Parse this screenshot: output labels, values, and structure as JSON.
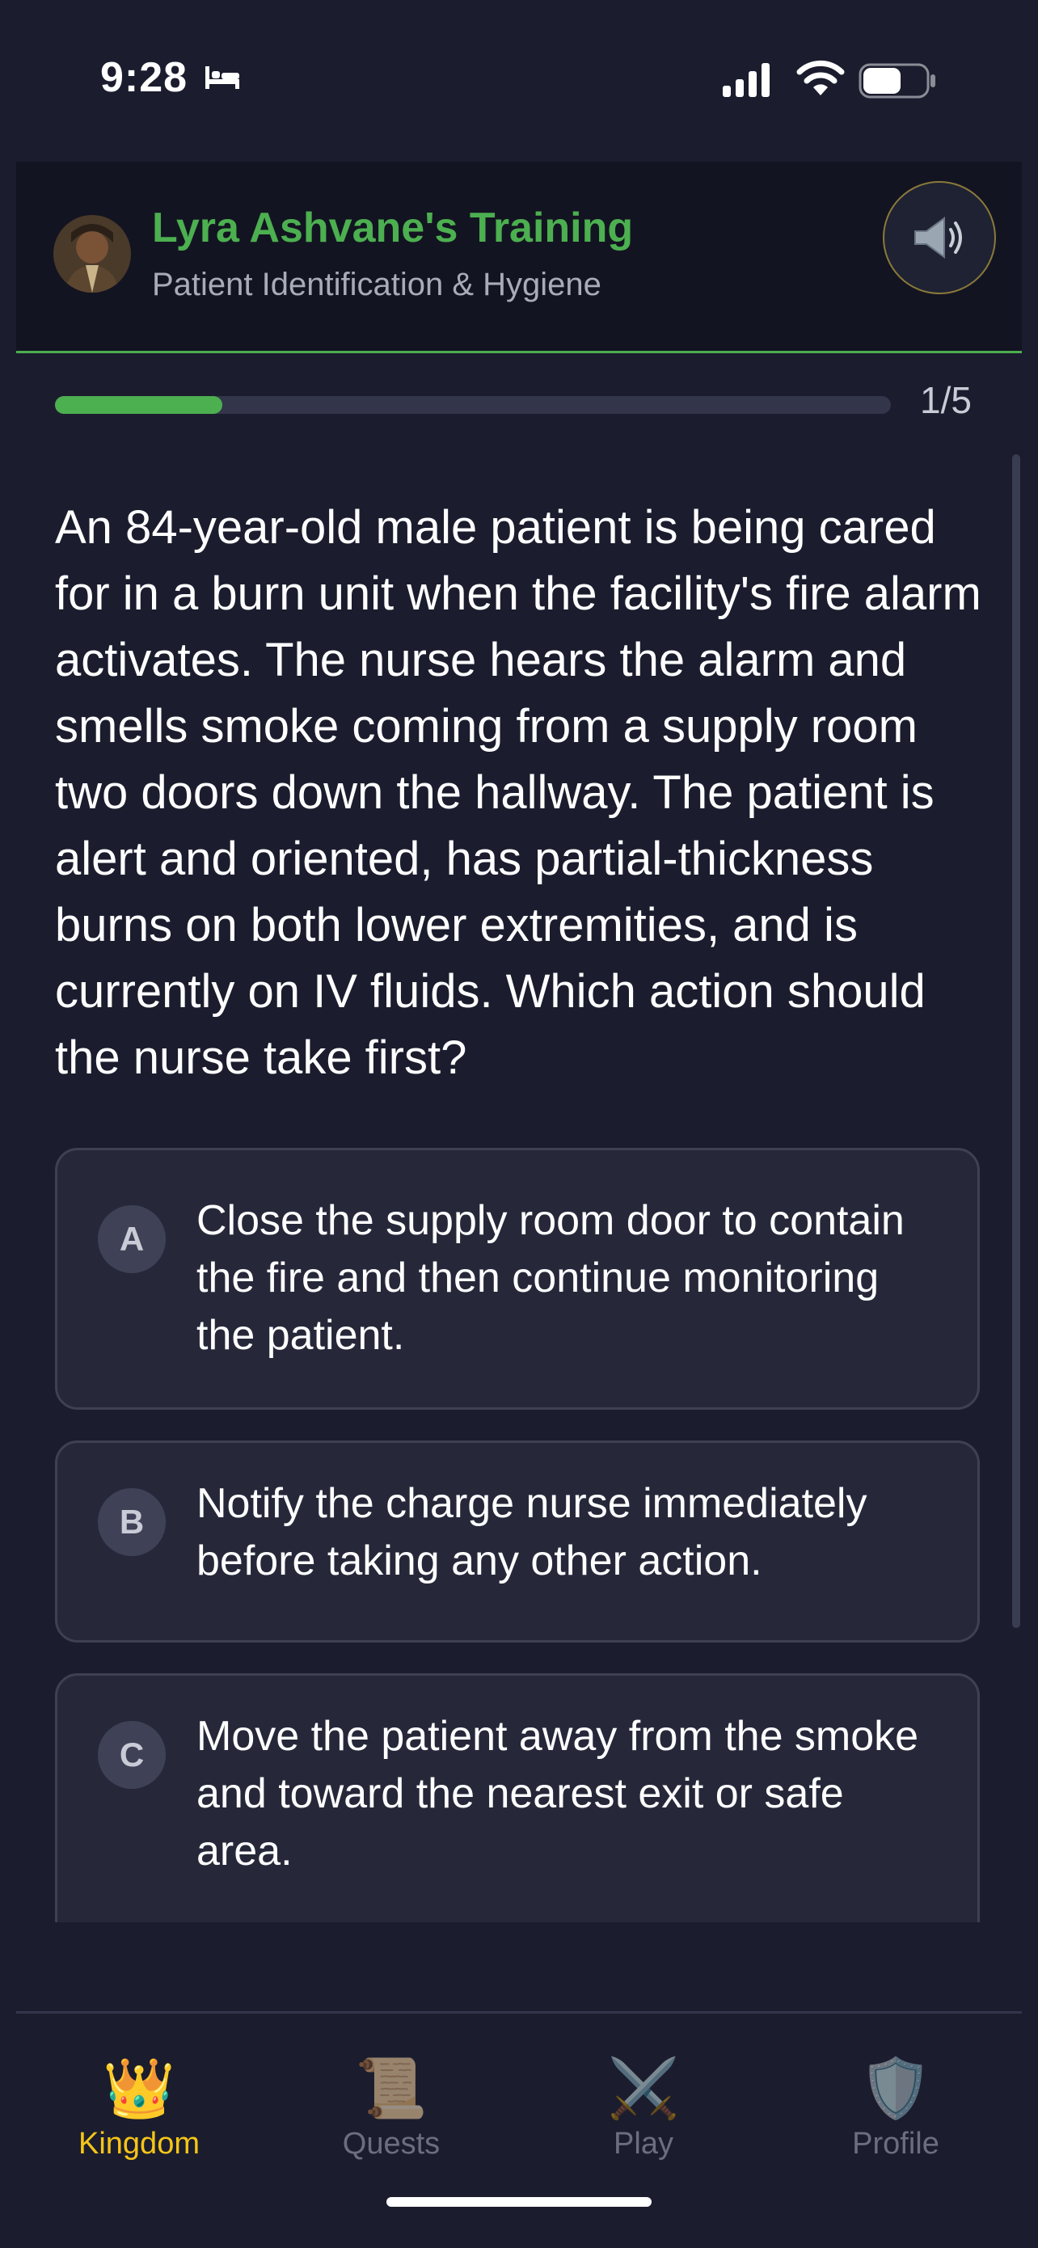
{
  "status_bar": {
    "time": "9:28"
  },
  "header": {
    "title": "Lyra Ashvane's Training",
    "subtitle": "Patient Identification & Hygiene"
  },
  "progress": {
    "current": 1,
    "total": 5,
    "fraction": 0.2,
    "label": "1/5"
  },
  "question": {
    "text": "An 84-year-old male patient is being cared for in a burn unit when the facility's fire alarm activates. The nurse hears the alarm and smells smoke coming from a supply room two doors down the hallway. The patient is alert and oriented, has partial-thickness burns on both lower extremities, and is currently on IV fluids. Which action should the nurse take first?"
  },
  "options": [
    {
      "letter": "A",
      "text": "Close the supply room door to contain the fire and then continue monitoring the patient."
    },
    {
      "letter": "B",
      "text": "Notify the charge nurse immediately before taking any other action."
    },
    {
      "letter": "C",
      "text": "Move the patient away from the smoke and toward the nearest exit or safe area."
    }
  ],
  "tabs": [
    {
      "icon": "crown-icon",
      "glyph": "👑",
      "label": "Kingdom",
      "active": true
    },
    {
      "icon": "scroll-icon",
      "glyph": "📜",
      "label": "Quests",
      "active": false
    },
    {
      "icon": "crossed-swords-icon",
      "glyph": "⚔️",
      "label": "Play",
      "active": false
    },
    {
      "icon": "shield-icon",
      "glyph": "🛡️",
      "label": "Profile",
      "active": false
    }
  ],
  "colors": {
    "background": "#1b1d2e",
    "accent_green": "#4caf50",
    "active_tab": "#f5c518",
    "inactive_tab": "#6b6e80"
  }
}
